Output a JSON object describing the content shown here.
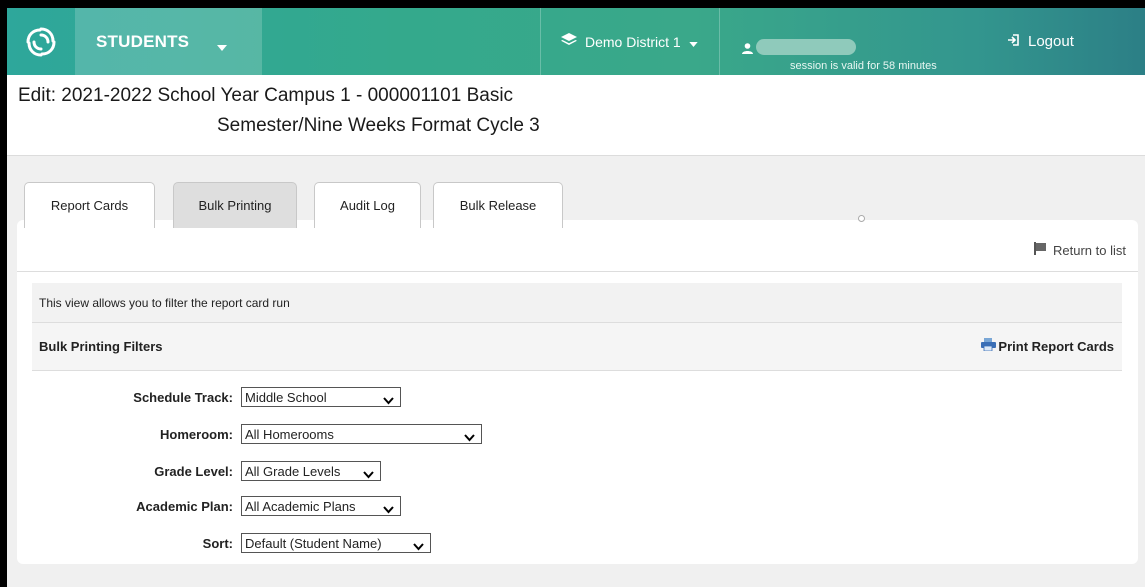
{
  "header": {
    "module_label": "STUDENTS",
    "district_label": "Demo District 1",
    "session_text": "session is valid for 58 minutes",
    "logout_label": "Logout"
  },
  "page": {
    "title_line1": "Edit: 2021-2022 School Year Campus 1 - 000001101 Basic",
    "title_line2": "Semester/Nine Weeks Format Cycle 3"
  },
  "tabs": [
    {
      "label": "Report Cards",
      "active": false
    },
    {
      "label": "Bulk Printing",
      "active": true
    },
    {
      "label": "Audit Log",
      "active": false
    },
    {
      "label": "Bulk Release",
      "active": false
    }
  ],
  "panel": {
    "return_label": "Return to list",
    "info_text": "This view allows you to filter the report card run",
    "filters_heading": "Bulk Printing Filters",
    "print_label": "Print Report Cards"
  },
  "filters": [
    {
      "label": "Schedule Track:",
      "value": "Middle School"
    },
    {
      "label": "Homeroom:",
      "value": "All Homerooms"
    },
    {
      "label": "Grade Level:",
      "value": "All Grade Levels"
    },
    {
      "label": "Academic Plan:",
      "value": "All Academic Plans"
    },
    {
      "label": "Sort:",
      "value": "Default (Student Name)"
    }
  ],
  "icons": {
    "logo": "swirl-logo-icon",
    "district": "layers-icon",
    "user": "person-icon",
    "logout": "logout-icon",
    "return": "flag-icon",
    "print": "printer-icon"
  }
}
